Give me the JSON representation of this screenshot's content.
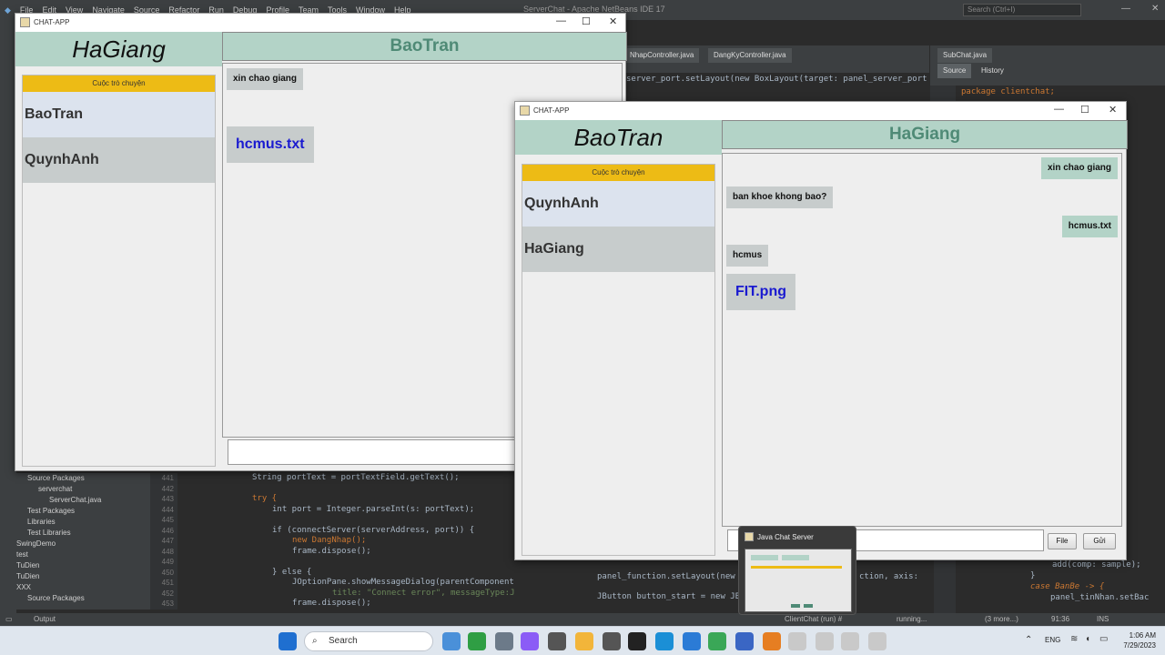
{
  "ide": {
    "menu": [
      "File",
      "Edit",
      "View",
      "Navigate",
      "Source",
      "Refactor",
      "Run",
      "Debug",
      "Profile",
      "Team",
      "Tools",
      "Window",
      "Help"
    ],
    "title": "ServerChat - Apache NetBeans IDE 17",
    "search_placeholder": "Search (Ctrl+I)",
    "tabs": [
      "NhapController.java",
      "DangKyController.java",
      "SubChat.java"
    ],
    "source_tab": "Source",
    "history_tab": "History",
    "tree": [
      "Source Packages",
      "serverchat",
      "ServerChat.java",
      "Test Packages",
      "Libraries",
      "Test Libraries",
      "SwingDemo",
      "test",
      "TuDien",
      "TuDien",
      "XXX",
      "Source Packages"
    ],
    "gutter": [
      "441",
      "442",
      "443",
      "444",
      "445",
      "446",
      "447",
      "448",
      "449",
      "450",
      "451",
      "452",
      "453"
    ],
    "code_line_1": "String portText = portTextField.getText();",
    "code_line_2": "try {",
    "code_line_3": "int port = Integer.parseInt(s: portText);",
    "code_line_4": "if (connectServer(serverAddress, port)) {",
    "code_line_5": "new DangNhap();",
    "code_line_6": "frame.dispose();",
    "code_line_7": "} else {",
    "code_line_8": "JOptionPane.showMessageDialog(parentComponent:",
    "code_line_9": "title: \"Connect error\", messageType:JOpt",
    "code_line_10": "frame.dispose();",
    "mid_code_1": "server_port.setLayout(new BoxLayout(target: panel_server_port",
    "mid_code_2": "panel_function.setLayout(new",
    "mid_code_3": "JButton button_start = new JB",
    "mid_code_4": "ction, axis:",
    "right_code_1": "package clientchat;",
    "right_code_2": "add(comp: sample);",
    "right_code_3": "}",
    "right_code_4": "case BanBe -> {",
    "right_code_5": "panel_tinNhan.setBac",
    "output_label": "Output",
    "status_run": "ClientChat (run) #",
    "status_running": "running...",
    "status_more": "(3 more...)",
    "status_pos": "91:36",
    "status_ins": "INS"
  },
  "window1": {
    "title": "CHAT-APP",
    "user_name": "HaGiang",
    "chat_partner": "BaoTran",
    "list_header": "Cuộc trò chuyện",
    "contacts": [
      "BaoTran",
      "QuynhAnh"
    ],
    "messages": [
      {
        "text": "xin chao giang",
        "kind": "text"
      },
      {
        "text": "hcmus.txt",
        "kind": "file"
      }
    ]
  },
  "window2": {
    "title": "CHAT-APP",
    "user_name": "BaoTran",
    "chat_partner": "HaGiang",
    "list_header": "Cuộc trò chuyện",
    "contacts": [
      "QuynhAnh",
      "HaGiang"
    ],
    "messages": [
      {
        "text": "xin chao giang",
        "kind": "text",
        "side": "right"
      },
      {
        "text": "ban khoe khong bao?",
        "kind": "text",
        "side": "left"
      },
      {
        "text": "hcmus.txt",
        "kind": "text",
        "side": "right"
      },
      {
        "text": "hcmus",
        "kind": "text",
        "side": "left"
      },
      {
        "text": "FIT.png",
        "kind": "file",
        "side": "left"
      }
    ],
    "file_button": "File",
    "send_button": "Gửi"
  },
  "preview": {
    "title": "Java Chat Server"
  },
  "taskbar": {
    "search_label": "Search",
    "lang": "ENG",
    "time": "1:06 AM",
    "date": "7/29/2023"
  }
}
